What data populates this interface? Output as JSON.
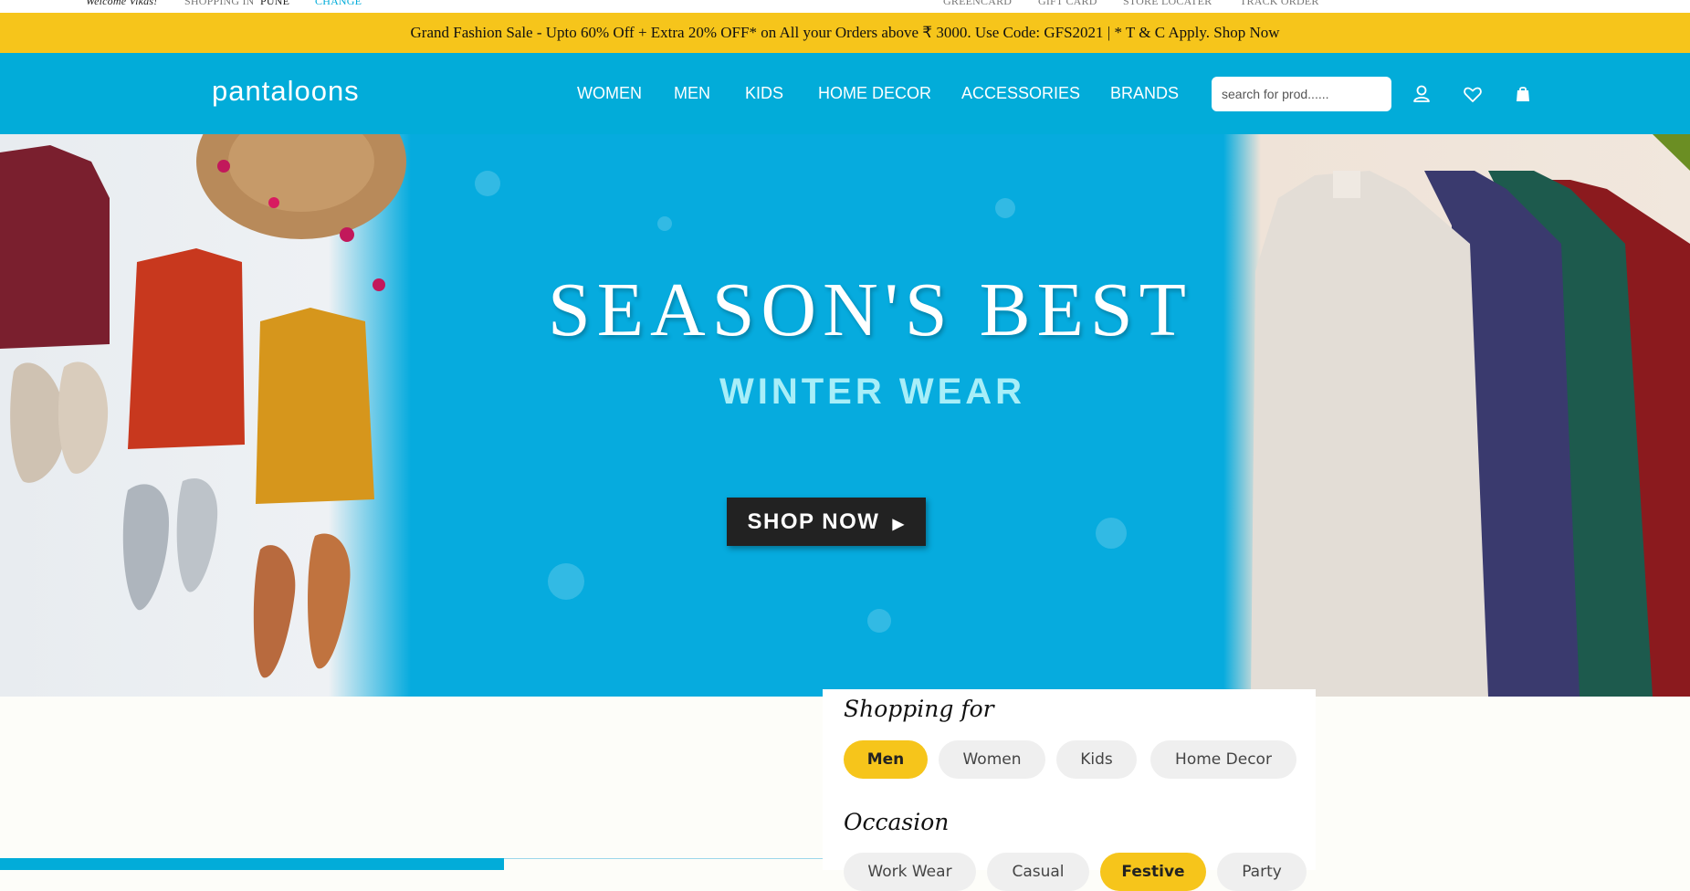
{
  "topbar": {
    "welcome": "Welcome Vikas!",
    "shopping_in": "SHOPPING IN",
    "city": "PUNE",
    "change": "CHANGE",
    "links": [
      "GREENCARD",
      "GIFT CARD",
      "STORE LOCATER",
      "TRACK ORDER"
    ]
  },
  "promo": {
    "text": "Grand Fashion Sale - Upto 60% Off + Extra 20% OFF* on All your Orders above ₹ 3000. Use Code: GFS2021 | * T & C Apply. Shop Now"
  },
  "header": {
    "logo": "pantaloons",
    "nav": [
      "WOMEN",
      "MEN",
      "KIDS",
      "HOME DECOR",
      "ACCESSORIES",
      "BRANDS"
    ],
    "search_placeholder": "search for prod......",
    "icons": [
      "user-icon",
      "heart-icon",
      "bag-icon"
    ]
  },
  "hero": {
    "title": "SEASON'S BEST",
    "subtitle": "WINTER WEAR",
    "cta": "SHOP NOW"
  },
  "filter": {
    "shopping_for_label": "Shopping for",
    "shopping_for_options": [
      "Men",
      "Women",
      "Kids",
      "Home Decor"
    ],
    "shopping_for_selected": "Men",
    "occasion_label": "Occasion",
    "occasion_options": [
      "Work Wear",
      "Casual",
      "Festive",
      "Party"
    ],
    "occasion_selected": "Festive"
  },
  "colors": {
    "brand_blue": "#02acd9",
    "accent_yellow": "#f6c51b"
  }
}
